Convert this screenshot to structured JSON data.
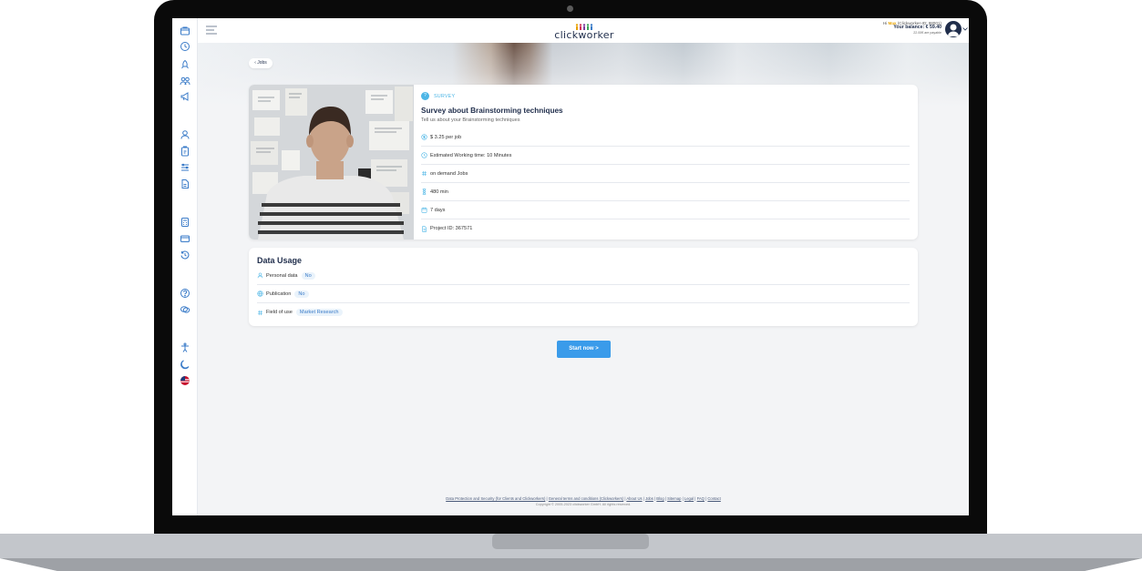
{
  "header": {
    "logo_text": "clickworker",
    "greeting_prefix": "Hi",
    "user_name": "Max",
    "user_id": "(Clickworker-ID: 98001)",
    "balance": "Your balance: € 59.40",
    "payable": "22.00€ are payable"
  },
  "nav": {
    "back_label": "Jobs"
  },
  "job": {
    "category": "SURVEY",
    "title": "Survey about Brainstorming techniques",
    "subtitle": "Tell us about your Brainstorming techniques",
    "details": [
      {
        "icon": "money-icon",
        "text": "$ 3.25 per job"
      },
      {
        "icon": "clock-icon",
        "text": "Estimated Working time: 10 Minutes"
      },
      {
        "icon": "hash-icon",
        "text": "on demand Jobs"
      },
      {
        "icon": "hourglass-icon",
        "text": "480 min"
      },
      {
        "icon": "calendar-icon",
        "text": "7 days"
      },
      {
        "icon": "document-icon",
        "text": "Project ID: 367571"
      }
    ]
  },
  "data_usage": {
    "title": "Data Usage",
    "rows": [
      {
        "icon": "person-icon",
        "label": "Personal data",
        "value": "No"
      },
      {
        "icon": "globe-icon",
        "label": "Publication",
        "value": "No"
      },
      {
        "icon": "hash-icon",
        "label": "Field of use",
        "value": "Market Research"
      }
    ]
  },
  "actions": {
    "start_label": "Start now >"
  },
  "footer": {
    "links": [
      "Data Protection and Security (for Clients and Clickworkers)",
      "General terms and conditions (Clickworkers)",
      "About Us",
      "Jobs",
      "Blog",
      "Sitemap",
      "Legal",
      "FAQ",
      "Contact"
    ],
    "copyright": "Copyright © 2005-2023 clickworker GmbH. All rights reserved."
  },
  "colors": {
    "accent": "#3a9bea",
    "navy": "#1f2d4b",
    "survey": "#4db6e6",
    "highlight": "#e8a300"
  }
}
